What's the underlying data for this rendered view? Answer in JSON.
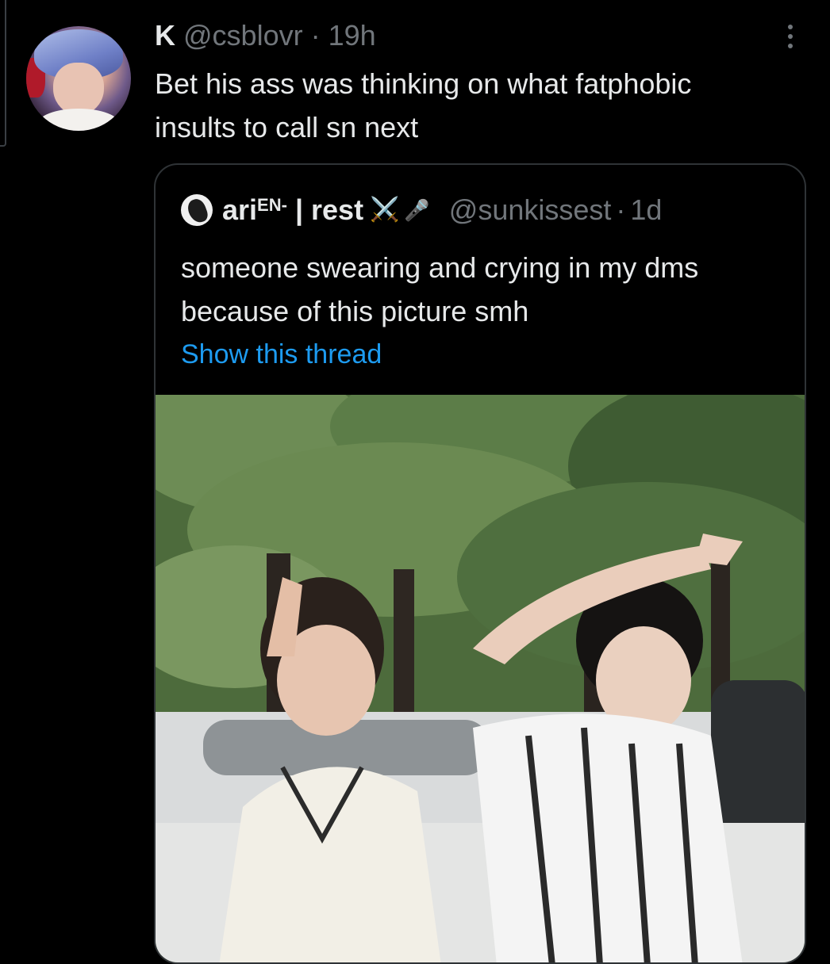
{
  "tweet": {
    "display_name": "K",
    "handle": "@csblovr",
    "separator": "·",
    "time": "19h",
    "text": "Bet his ass was thinking on what fatphobic insults to call sn next"
  },
  "quoted_tweet": {
    "display_name": "ari",
    "display_name_sup": "EN-",
    "display_name_suffix": " | rest",
    "emoji_1": "⚔️",
    "emoji_2": "🎤",
    "handle": "@sunkissest",
    "separator": "·",
    "time": "1d",
    "text": "someone swearing and crying in my dms because of this picture smh",
    "show_thread_label": "Show this thread"
  },
  "icons": {
    "more": "more-icon",
    "avatar": "avatar",
    "quoted_avatar": "quoted-avatar"
  },
  "colors": {
    "background": "#000000",
    "text": "#e7e9ea",
    "secondary_text": "#71767b",
    "link": "#1d9bf0",
    "border": "#2f3336"
  }
}
